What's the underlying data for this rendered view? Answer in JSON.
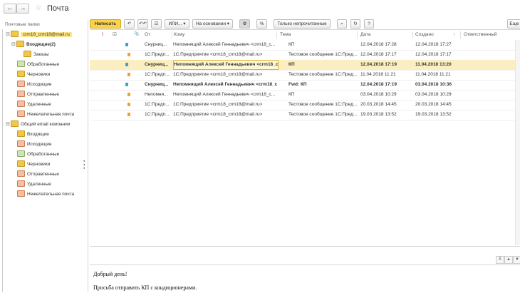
{
  "header": {
    "title": "Почта",
    "back_glyph": "←",
    "forward_glyph": "→",
    "star_glyph": "☆"
  },
  "sidebar": {
    "heading": "Почтовые папки",
    "tree": [
      {
        "label": "crm18_crm18@mail.ru",
        "selected": true,
        "icon": "folder-icon"
      },
      {
        "label": "Входящие(2)",
        "bold": true,
        "icon": "folder-icon"
      },
      {
        "label": "Заказы",
        "icon": "folder-icon"
      },
      {
        "label": "Обработанные",
        "icon": "folder-check-icon"
      },
      {
        "label": "Черновики",
        "icon": "folder-draft-icon"
      },
      {
        "label": "Исходящие",
        "icon": "folder-outgoing-icon"
      },
      {
        "label": "Отправленные",
        "icon": "folder-sent-icon"
      },
      {
        "label": "Удаленные",
        "icon": "folder-deleted-icon"
      },
      {
        "label": "Нежелательная почта",
        "icon": "folder-spam-icon"
      },
      {
        "label": "Общий email компании",
        "icon": "folder-icon"
      },
      {
        "label": "Входящие",
        "icon": "folder-icon"
      },
      {
        "label": "Исходящие",
        "icon": "folder-outgoing-icon"
      },
      {
        "label": "Обработанные",
        "icon": "folder-check-icon"
      },
      {
        "label": "Черновики",
        "icon": "folder-draft-icon"
      },
      {
        "label": "Отправленные",
        "icon": "folder-sent-icon"
      },
      {
        "label": "Удаленные",
        "icon": "folder-deleted-icon"
      },
      {
        "label": "Нежелательная почта",
        "icon": "folder-spam-icon"
      }
    ]
  },
  "toolbar": {
    "compose": "Написать",
    "reply_icon": "↶",
    "reply_all_icon": "↶↶",
    "check_icon": "☑",
    "or_label": "ИЛИ...",
    "based_on_label": "На основании",
    "settings_icon": "⚙",
    "percent_icon": "%",
    "unread_only": "Только непрочитанные",
    "search_icon": "⌕",
    "refresh_icon": "↻",
    "help_icon": "?",
    "more_label": "Еще"
  },
  "grid": {
    "columns": {
      "importance": "!",
      "read": "☑",
      "attach": "📎",
      "from": "От",
      "to": "Кому",
      "subject": "Тема",
      "date": "Дата",
      "created": "Создано",
      "sort_arrow": "↑",
      "responsible": "Ответственный"
    },
    "rows": [
      {
        "dir": "in",
        "from": "Снурниц...",
        "to": "Непомнящий Алексей Геннадьевич <crm18_c...",
        "subject": "КП",
        "date": "12.04.2018 17:28",
        "created": "12.04.2018 17:27",
        "unread": false,
        "selected": false
      },
      {
        "dir": "out",
        "from": "1С:Предп...",
        "to": "1С:Предприятие <crm18_crm18@mail.ru>",
        "subject": "Тестовое сообщение 1С:Пред...",
        "date": "12.04.2018 17:17",
        "created": "12.04.2018 17:17",
        "unread": false,
        "selected": false
      },
      {
        "dir": "in",
        "from": "Снурниц...",
        "to": "Непомнящий Алексей Геннадьевич <crm18_cr...",
        "subject": "КП",
        "date": "12.04.2018 17:19",
        "created": "11.04.2018 13:20",
        "unread": true,
        "selected": true
      },
      {
        "dir": "out",
        "from": "1С:Предп...",
        "to": "1С:Предприятие <crm18_crm18@mail.ru>",
        "subject": "Тестовое сообщение 1С:Пред...",
        "date": "11.04.2018 11:21",
        "created": "11.04.2018 11:21",
        "unread": false,
        "selected": false
      },
      {
        "dir": "in",
        "from": "Снурниц...",
        "to": "Непомнящий Алексей Геннадьевич <crm18_cr...",
        "subject": "Fwd: КП",
        "date": "12.04.2018 17:19",
        "created": "03.04.2018 10:36",
        "unread": true,
        "selected": false
      },
      {
        "dir": "out",
        "from": "Непомня...",
        "to": "Непомнящий Алексей Геннадьевич <crm18_c...",
        "subject": "КП",
        "date": "03.04.2018 10:29",
        "created": "03.04.2018 10:29",
        "unread": false,
        "selected": false
      },
      {
        "dir": "out",
        "from": "1С:Предп...",
        "to": "1С:Предприятие <crm18_crm18@mail.ru>",
        "subject": "Тестовое сообщение 1С:Пред...",
        "date": "20.03.2018 14:45",
        "created": "20.03.2018 14:45",
        "unread": false,
        "selected": false
      },
      {
        "dir": "out",
        "from": "1С:Предп...",
        "to": "1С:Предприятие <crm18_crm18@mail.ru>",
        "subject": "Тестовое сообщение 1С:Пред...",
        "date": "19.03.2018 13:52",
        "created": "19.03.2018 13:52",
        "unread": false,
        "selected": false
      }
    ]
  },
  "preview": {
    "collapse_icons": [
      "⊼",
      "▲",
      "▼"
    ],
    "greeting": "Добрый день!",
    "body": "Просьба отправить КП с кондиционерами."
  },
  "colors": {
    "accent": "#fbd34b",
    "selected_row": "#fbeec0",
    "incoming_arrow": "#3aa0d8",
    "outgoing_arrow": "#f0a030"
  }
}
